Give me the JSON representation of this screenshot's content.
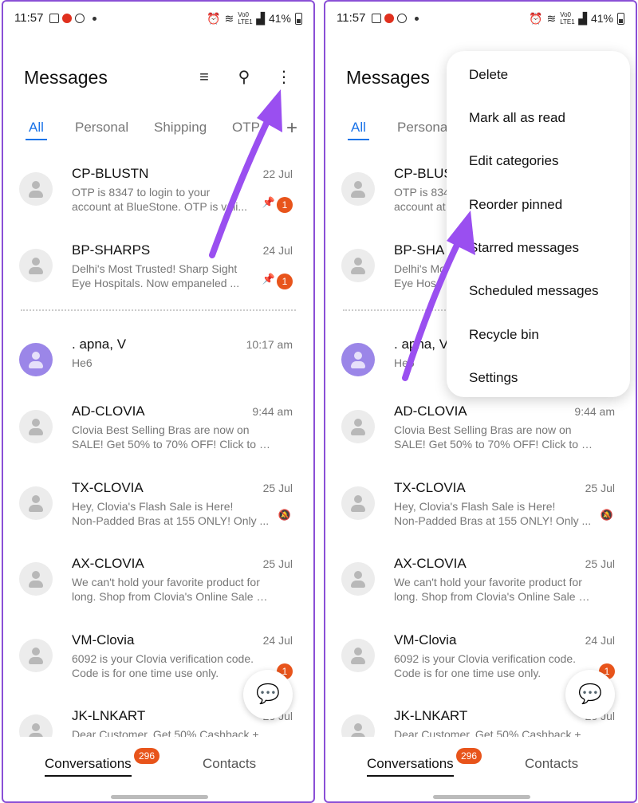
{
  "status_bar": {
    "time": "11:57",
    "network": "Vo0 LTE1",
    "battery": "41%"
  },
  "header": {
    "title": "Messages",
    "icons": [
      "filter-icon",
      "search-icon",
      "more-vert-icon"
    ]
  },
  "tabs": [
    "All",
    "Personal",
    "Shipping",
    "OTP"
  ],
  "tabs_visible_right": [
    "All",
    "Persona"
  ],
  "pinned": [
    {
      "name": "CP-BLUSTN",
      "date": "22 Jul",
      "line1": "OTP is 8347 to login to your",
      "line2": "account at BlueStone. OTP is vali...",
      "badge": "1"
    },
    {
      "name": "BP-SHARPS",
      "date": "24 Jul",
      "line1": "Delhi's Most Trusted! Sharp Sight",
      "line2": "Eye Hospitals. Now empaneled ...",
      "badge": "1"
    }
  ],
  "right_pinned_names": [
    "CP-BLUS",
    "BP-SHA"
  ],
  "right_pinned_lines": [
    {
      "line1": "OTP is 834",
      "line2": "account at"
    },
    {
      "line1": "Delhi's Mo",
      "line2": "Eye Hos"
    }
  ],
  "conversations": [
    {
      "name": ". apna, V",
      "date": "10:17 am",
      "line1": "He6",
      "line2": ""
    },
    {
      "name": "AD-CLOVIA",
      "date": "9:44 am",
      "line1": "Clovia Best Selling Bras are now on",
      "line2": "SALE! Get 50% to 70% OFF! Click to Sho..."
    },
    {
      "name": "TX-CLOVIA",
      "date": "25 Jul",
      "line1": "Hey, Clovia's Flash Sale is Here!",
      "line2": "Non-Padded Bras at 155 ONLY! Only ..."
    },
    {
      "name": "AX-CLOVIA",
      "date": "25 Jul",
      "line1": "We can't hold your favorite product for",
      "line2": "long. Shop from Clovia's Online Sale an..."
    },
    {
      "name": "VM-Clovia",
      "date": "24 Jul",
      "line1": "6092 is your Clovia verification code.",
      "line2": "Code is for one time use only.",
      "badge": "1"
    },
    {
      "name": "JK-LNKART",
      "date": "25 Jul",
      "line1": "Dear Customer, Get 50% Cashback +",
      "line2": ""
    }
  ],
  "right_apna": {
    "name": ". apna, V",
    "line1": "He6"
  },
  "bottom_nav": {
    "conversations": "Conversations",
    "badge": "296",
    "contacts": "Contacts"
  },
  "menu": [
    "Delete",
    "Mark all as read",
    "Edit categories",
    "Reorder pinned",
    "Starred messages",
    "Scheduled messages",
    "Recycle bin",
    "Settings"
  ],
  "colors": {
    "accent": "#1a73e8",
    "badge": "#e8541b",
    "arrow": "#9a4ff0",
    "avatar_purple": "#9b86e8"
  }
}
